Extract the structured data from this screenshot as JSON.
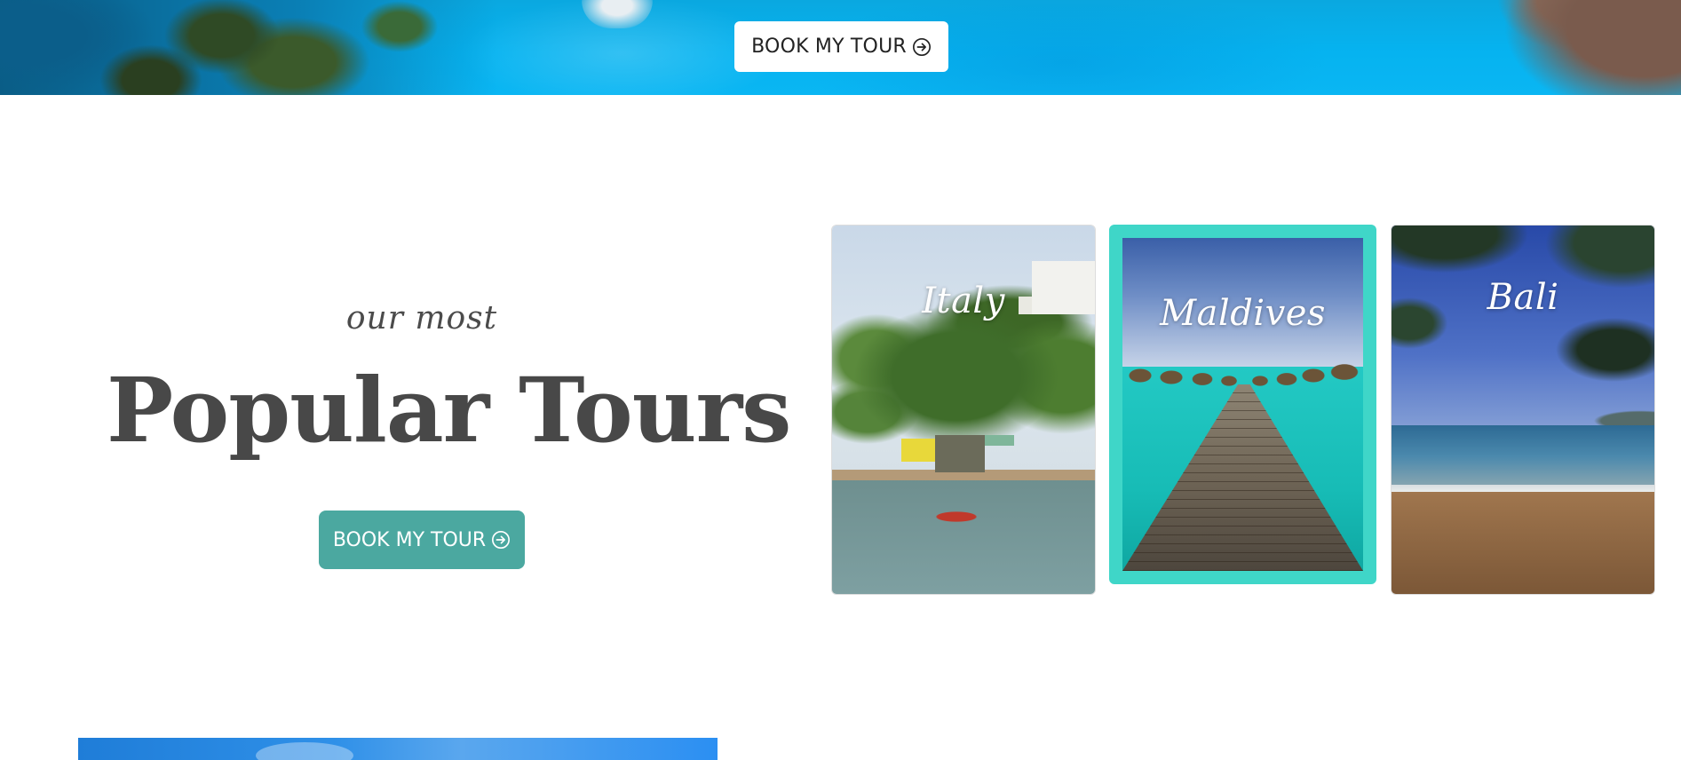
{
  "hero": {
    "book_button": {
      "label": "BOOK MY TOUR",
      "icon": "arrow-circle-right-icon"
    }
  },
  "intro": {
    "eyebrow": "our most",
    "title": "Popular Tours",
    "book_button": {
      "label": "BOOK MY TOUR",
      "icon": "arrow-circle-right-icon",
      "color": "#4ba8a0"
    }
  },
  "tours": [
    {
      "label": "Italy"
    },
    {
      "label": "Maldives",
      "highlight_color": "#3fd6c8"
    },
    {
      "label": "Bali"
    }
  ]
}
